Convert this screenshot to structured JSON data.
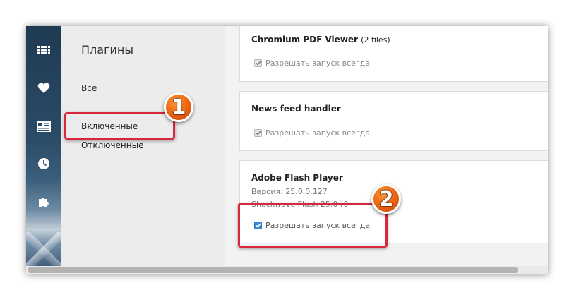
{
  "sidebar": {
    "icons": [
      "apps-grid-icon",
      "favorites-heart-icon",
      "news-icon",
      "history-clock-icon",
      "extensions-puzzle-icon"
    ]
  },
  "nav": {
    "title": "Плагины",
    "items": [
      {
        "label": "Все"
      },
      {
        "label": "Включенные"
      },
      {
        "label": "Отключенные"
      }
    ]
  },
  "plugins": [
    {
      "name": "Chromium PDF Viewer",
      "files": "(2 files)",
      "allow_label": "Разрешать запуск всегда",
      "checked": true
    },
    {
      "name": "News feed handler",
      "allow_label": "Разрешать запуск всегда",
      "checked": true
    },
    {
      "name": "Adobe Flash Player",
      "version": "Версия: 25.0.0.127",
      "subname": "Shockwave Flash 25.0 r0",
      "allow_label": "Разрешать запуск всегда",
      "checked": true
    }
  ],
  "annotations": {
    "badge1": "1",
    "badge2": "2",
    "color": "#d8273a"
  }
}
